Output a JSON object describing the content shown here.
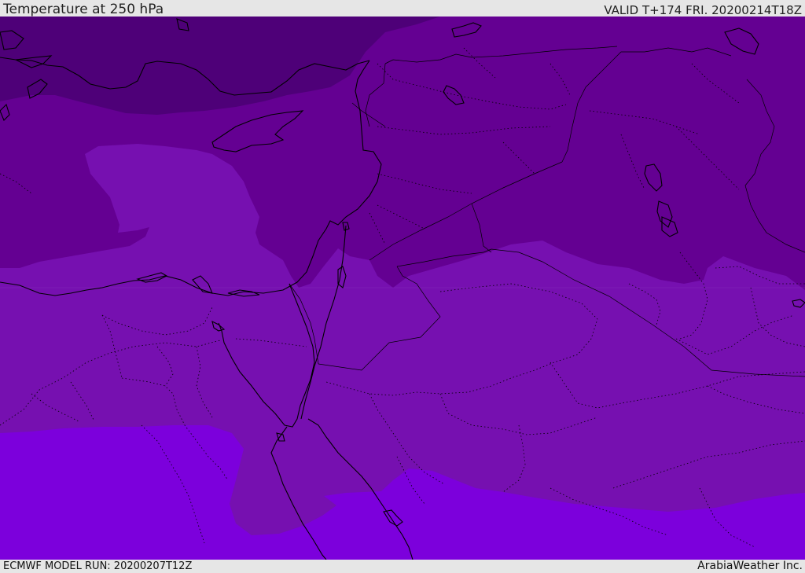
{
  "header": {
    "title": "Temperature at 250 hPa",
    "valid": "VALID T+174 FRI. 20200214T18Z"
  },
  "footer": {
    "model_run": "ECMWF MODEL RUN: 20200207T12Z",
    "credit": "ArabiaWeather Inc."
  },
  "map": {
    "field": "temperature",
    "level": "250 hPa",
    "colors": {
      "coldest": "#4e0078",
      "cold": "#640092",
      "mid": "#7610b0",
      "warm": "#7c00dc",
      "coast": "#000000",
      "border": "#000000"
    }
  }
}
